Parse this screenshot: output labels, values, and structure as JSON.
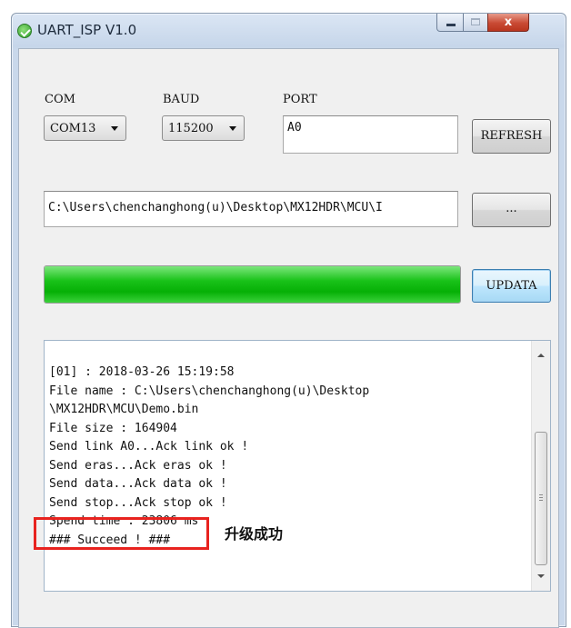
{
  "window": {
    "title": "UART_ISP V1.0",
    "controls": {
      "minimize": "",
      "maximize": "",
      "close": "x"
    }
  },
  "com": {
    "label": "COM",
    "selected": "COM13"
  },
  "baud": {
    "label": "BAUD",
    "selected": "115200"
  },
  "port": {
    "label": "PORT",
    "value": "A0"
  },
  "buttons": {
    "refresh": "REFRESH",
    "browse": "...",
    "update": "UPDATA"
  },
  "file_path": "C:\\Users\\chenchanghong(u)\\Desktop\\MX12HDR\\MCU\\I",
  "progress": {
    "fraction": 1.0,
    "color": "#10c010"
  },
  "log": {
    "lines": [
      "[01] : 2018-03-26 15:19:58",
      "File name : C:\\Users\\chenchanghong(u)\\Desktop",
      "\\MX12HDR\\MCU\\Demo.bin",
      "File size : 164904",
      "Send link A0...Ack link ok !",
      "Send eras...Ack eras ok !",
      "Send data...Ack data ok !",
      "Send stop...Ack stop ok !",
      "Spend time : 23806 ms",
      "### Succeed ! ###"
    ]
  },
  "annotation": {
    "text": "升级成功",
    "box_color": "#e8231f"
  }
}
